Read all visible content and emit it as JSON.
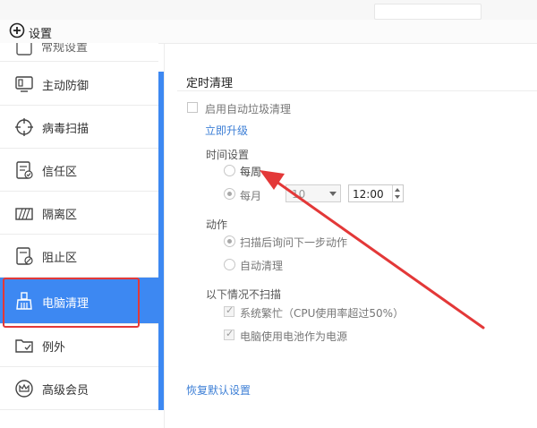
{
  "window": {
    "title": "设置",
    "title_icon": "plus-circle-icon"
  },
  "sidebar": {
    "cutoff_item": {
      "label": "常规设置",
      "icon": "gear-icon"
    },
    "items": [
      {
        "label": "主动防御",
        "icon": "monitor-shield-icon"
      },
      {
        "label": "病毒扫描",
        "icon": "crosshair-icon"
      },
      {
        "label": "信任区",
        "icon": "trust-list-icon"
      },
      {
        "label": "隔离区",
        "icon": "quarantine-icon"
      },
      {
        "label": "阻止区",
        "icon": "block-list-icon"
      },
      {
        "label": "电脑清理",
        "icon": "broom-icon",
        "active": true
      },
      {
        "label": "例外",
        "icon": "exception-folder-icon"
      },
      {
        "label": "高级会员",
        "icon": "crown-icon"
      }
    ]
  },
  "main": {
    "section_title": "定时清理",
    "enable_label": "启用自动垃圾清理",
    "upgrade_link": "立即升级",
    "time_group": "时间设置",
    "weekly_label": "每周",
    "monthly_label": "每月",
    "day_select_value": "10",
    "time_value": "12:00",
    "action_group": "动作",
    "action_ask_label": "扫描后询问下一步动作",
    "action_auto_label": "自动清理",
    "skip_group": "以下情况不扫描",
    "skip_busy_label": "系统繁忙（CPU使用率超过50%）",
    "skip_battery_label": "电脑使用电池作为电源",
    "restore_link": "恢复默认设置"
  },
  "colors": {
    "accent": "#3d88f2",
    "annotation": "#e33838",
    "link": "#3d7fd6"
  }
}
